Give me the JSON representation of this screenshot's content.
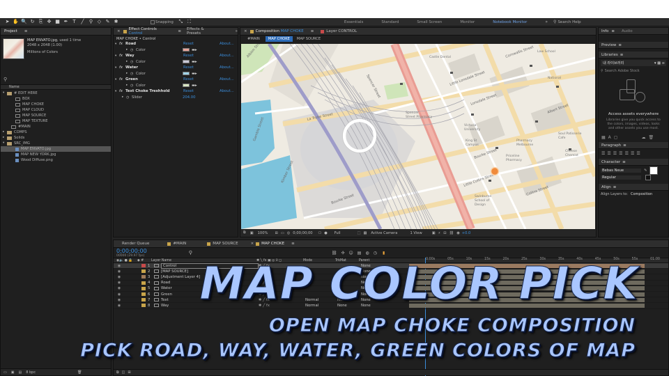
{
  "toolbar": {
    "snapping": "Snapping",
    "workspaces": [
      "Essentials",
      "Standard",
      "Small Screen",
      "Monitor",
      "Notebook Monitor"
    ],
    "active_workspace": "Notebook Monitor",
    "search_placeholder": "Search Help"
  },
  "project": {
    "tab": "Project",
    "file_name": "MAP ENVATO.jpg",
    "used": ", used 1 time",
    "dims": "2048 x 2048 (1.00)",
    "colors": "Millions of Colors",
    "col_name": "Name",
    "items": [
      {
        "label": "# EDIT HERE",
        "kind": "folder",
        "indent": 0
      },
      {
        "label": "BOX",
        "kind": "comp",
        "indent": 2
      },
      {
        "label": "MAP CHOKE",
        "kind": "comp",
        "indent": 2
      },
      {
        "label": "MAP CLOUD",
        "kind": "comp",
        "indent": 2
      },
      {
        "label": "MAP SOURCE",
        "kind": "comp",
        "indent": 2
      },
      {
        "label": "MAP TEXTURE",
        "kind": "comp",
        "indent": 2
      },
      {
        "label": "#MAIN",
        "kind": "comp",
        "indent": 1
      },
      {
        "label": "COMPS",
        "kind": "folder",
        "indent": 0
      },
      {
        "label": "Solids",
        "kind": "folder",
        "indent": 0
      },
      {
        "label": "SRC_IMG",
        "kind": "folder",
        "indent": 0
      },
      {
        "label": "MAP ENVATO.jpg",
        "kind": "img",
        "indent": 2,
        "selected": true
      },
      {
        "label": "MAP NEW YORK.jpg",
        "kind": "img",
        "indent": 2
      },
      {
        "label": "Wood Diffuse.png",
        "kind": "img",
        "indent": 2
      }
    ],
    "bpc": "8 bpc"
  },
  "effect_controls": {
    "tab": "Effect Controls",
    "tab_layer": "Control",
    "tab2": "Effects & Presets",
    "header": "MAP CHOKE • Control",
    "reset": "Reset",
    "about": "About...",
    "effects": [
      {
        "name": "Road",
        "prop": "Color",
        "swatch": "#e8a49a"
      },
      {
        "name": "Way",
        "prop": "Color",
        "swatch": "#c9c9d8"
      },
      {
        "name": "Water",
        "prop": "Color",
        "swatch": "#9fd3e8"
      },
      {
        "name": "Green",
        "prop": "Color",
        "swatch": "#d9e7c3"
      }
    ],
    "threshold_name": "Text Choke Treshhold",
    "slider_label": "Slider",
    "slider_value": "204.00"
  },
  "composition": {
    "tab": "Composition",
    "tab_comp": "MAP CHOKE",
    "layer_tab": "Layer",
    "layer_tab_name": "CONTROL",
    "breadcrumbs": [
      "#MAIN",
      "MAP CHOKE",
      "MAP SOURCE"
    ],
    "zoom": "100%",
    "timecode": "0;00;00;00",
    "resolution": "Full",
    "camera": "Active Camera",
    "views": "1 View",
    "exposure": "+0.0"
  },
  "map": {
    "streets": [
      "Albion Street",
      "Gamble Street",
      "Burns Street",
      "Hoey Street",
      "Kimber Street",
      "La Trobe Street",
      "Buckingham Street",
      "Bourke Street",
      "Collins Street",
      "Little Collins Street",
      "Little Bourke Street",
      "Lonsdale Street",
      "Cornwallis Street",
      "Flinders Street",
      "Druitt Street",
      "Campbell Street",
      "Albert Street",
      "Smith Street",
      "Cobb Street",
      "Charlotte Street",
      "Mercury Street"
    ],
    "places": [
      "Victoria Park Primary School",
      "Castle Dental",
      "Spencer Street Pharmacy",
      "Victoria University",
      "Pharmacy Melbourne Central",
      "Priceline Pharmacy",
      "Royal Melbourne Institute",
      "Pharmacy Maribyrnong",
      "National",
      "Law School",
      "Soul Patisserie Cafe",
      "Cheese Chemist",
      "Spencer Street Pharmacy",
      "Little Collins Street",
      "School of Design",
      "Little Lonsdale Street",
      "Collins Street"
    ]
  },
  "info_panel": {
    "tabs": [
      "Info",
      "Audio"
    ],
    "preview": "Preview",
    "libraries": "Libraries",
    "library_name": "내 라이브러리",
    "search_placeholder": "Search Adobe Stock",
    "empty_title": "Access assets everywhere",
    "empty_body": "Libraries give you quick access to the colors, images, videos, looks and other assets you use most.",
    "paragraph": "Paragraph",
    "character": "Character",
    "font": "Bebas Neue",
    "font_style": "Regular",
    "align": "Align",
    "align_to_label": "Align Layers to:",
    "align_to": "Composition"
  },
  "timeline": {
    "tabs": [
      "Render Queue",
      "#MAIN",
      "MAP SOURCE",
      "MAP CHOKE"
    ],
    "active_tab": "MAP CHOKE",
    "timecode": "0;00;00;00",
    "fps": "00000 (29.97 fps)",
    "col_layer": "Layer Name",
    "col_mode": "Mode",
    "col_trkmat": "TrkMat",
    "col_parent": "Parent",
    "ruler": [
      "0:00s",
      "05s",
      "10s",
      "15s",
      "20s",
      "25s",
      "30s",
      "35s",
      "40s",
      "45s",
      "50s",
      "55s",
      "01:00"
    ],
    "layers": [
      {
        "num": "1",
        "name": "Control",
        "mode": "",
        "trk": "",
        "parent": "None",
        "color": "#c84a4a",
        "selected": true
      },
      {
        "num": "2",
        "name": "[MAP SOURCE]",
        "mode": "",
        "trk": "",
        "parent": "None",
        "color": "#c8a44a"
      },
      {
        "num": "3",
        "name": "[Adjustment Layer 4]",
        "mode": "",
        "trk": "",
        "parent": "None",
        "color": "#a07b59"
      },
      {
        "num": "4",
        "name": "Road",
        "mode": "",
        "trk": "",
        "parent": "None",
        "color": "#c8a44a"
      },
      {
        "num": "5",
        "name": "Water",
        "mode": "",
        "trk": "",
        "parent": "None",
        "color": "#c8a44a"
      },
      {
        "num": "6",
        "name": "Green",
        "mode": "",
        "trk": "",
        "parent": "None",
        "color": "#c8a44a"
      },
      {
        "num": "7",
        "name": "Text",
        "mode": "Normal",
        "trk": "None",
        "parent": "None",
        "color": "#c8a44a"
      },
      {
        "num": "8",
        "name": "Way",
        "mode": "Normal",
        "trk": "None",
        "parent": "None",
        "color": "#c8a44a"
      }
    ]
  },
  "overlay": {
    "title": "MAP COLOR PICK",
    "line1": "OPEN MAP CHOKE COMPOSITION",
    "line2": "PICK ROAD, WAY, WATER, GREEN COLORS OF MAP"
  }
}
